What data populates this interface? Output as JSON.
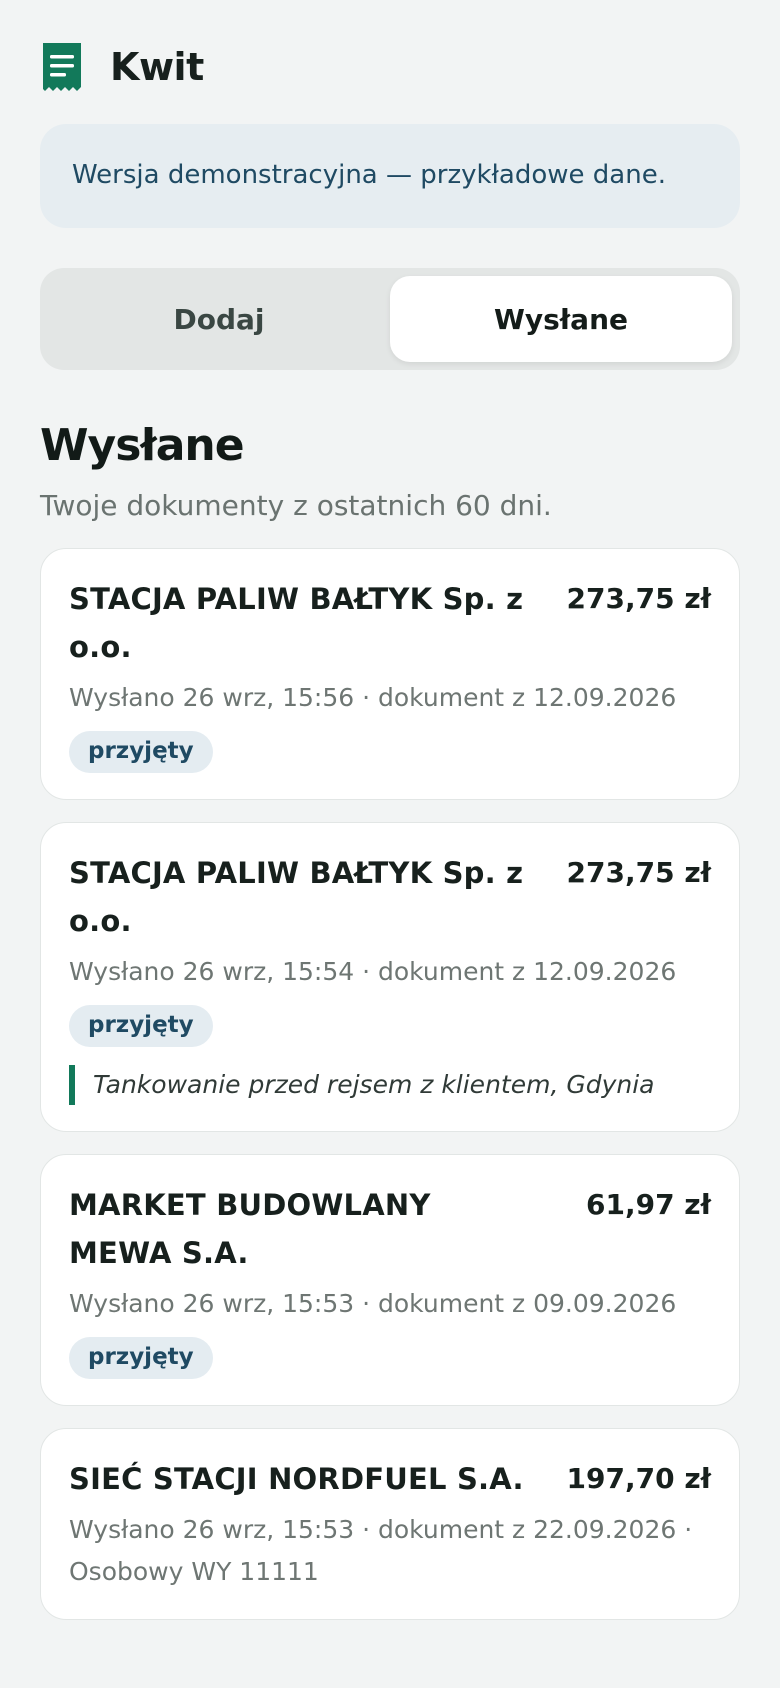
{
  "app": {
    "title": "Kwit",
    "logo_icon": "receipt-icon",
    "accent_color": "#12795a"
  },
  "demo_banner": {
    "text": "Wersja demonstracyjna — przykładowe dane."
  },
  "tabs": [
    {
      "label": "Dodaj",
      "active": false
    },
    {
      "label": "Wysłane",
      "active": true
    }
  ],
  "section": {
    "title": "Wysłane",
    "subtitle": "Twoje dokumenty z ostatnich 60 dni."
  },
  "documents": [
    {
      "merchant": "STACJA PALIW BAŁTYK Sp. z o.o.",
      "amount": "273,75 zł",
      "meta": "Wysłano 26 wrz, 15:56 · dokument z 12.09.2026",
      "status": "przyjęty",
      "note": ""
    },
    {
      "merchant": "STACJA PALIW BAŁTYK Sp. z o.o.",
      "amount": "273,75 zł",
      "meta": "Wysłano 26 wrz, 15:54 · dokument z 12.09.2026",
      "status": "przyjęty",
      "note": "Tankowanie przed rejsem z klientem, Gdynia"
    },
    {
      "merchant": "MARKET BUDOWLANY MEWA S.A.",
      "amount": "61,97 zł",
      "meta": "Wysłano 26 wrz, 15:53 · dokument z 09.09.2026",
      "status": "przyjęty",
      "note": ""
    },
    {
      "merchant": "SIEĆ STACJI NORDFUEL S.A.",
      "amount": "197,70 zł",
      "meta": "Wysłano 26 wrz, 15:53 · dokument z 22.09.2026 · Osobowy WY 11111",
      "status": "",
      "note": ""
    }
  ]
}
